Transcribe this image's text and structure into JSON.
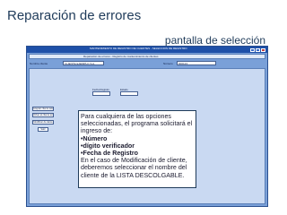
{
  "slide": {
    "title": "Reparación de errores",
    "subtitle": "pantalla de selección"
  },
  "window": {
    "title": "MANTENIMIENTO DE REGISTRO DE CLIENTES - SELECCION DE REGISTRO",
    "form_header": "Reparación de errores - Registro de mantenimiento de clientes",
    "search": {
      "name_label": "Nombre cliente",
      "name_value": "CLIENTE EJEMPLO S.A.",
      "number_label": "Número",
      "number_value": "000123"
    },
    "side_buttons": [
      "Aceptar cliente seleccionado",
      "Volver al cliente anterior",
      "Modificar de datos",
      "Salir"
    ],
    "panels": [
      "Fecha Registro",
      "Estado"
    ]
  },
  "callout": {
    "lines": [
      {
        "text": "Para cualquiera de las opciones",
        "bold": false
      },
      {
        "text": "seleccionadas, el programa solicitará el",
        "bold": false
      },
      {
        "text": "ingreso de:",
        "bold": false
      },
      {
        "text": "•Número",
        "bold": true
      },
      {
        "text": "•dígito verificador",
        "bold": true
      },
      {
        "text": "•Fecha de Registro",
        "bold": true
      },
      {
        "text": "En el caso de Modificación de cliente,",
        "bold": false
      },
      {
        "text": "deberemos seleccionar el nombre del",
        "bold": false
      },
      {
        "text": "cliente de la LISTA DESCOLGABLE.",
        "bold": false
      }
    ]
  }
}
